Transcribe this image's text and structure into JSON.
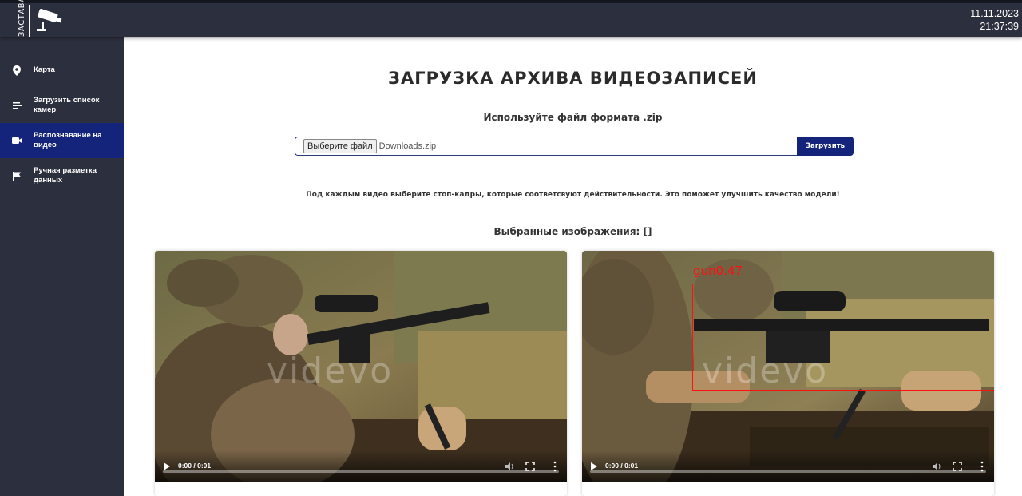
{
  "header": {
    "logo_text": "ЗАСТАВА",
    "date": "11.11.2023",
    "time": "21:37:39"
  },
  "sidebar": {
    "items": [
      {
        "label": "Карта",
        "icon": "map-pin-icon",
        "active": false
      },
      {
        "label": "Загрузить список камер",
        "icon": "list-icon",
        "active": false
      },
      {
        "label": "Распознавание на видео",
        "icon": "video-camera-icon",
        "active": true
      },
      {
        "label": "Ручная разметка данных",
        "icon": "flag-icon",
        "active": false
      }
    ]
  },
  "main": {
    "title": "ЗАГРУЗКА АРХИВА ВИДЕОЗАПИСЕЙ",
    "hint": "Используйте файл формата .zip",
    "file_button_label": "Выберите файл",
    "file_name": "Downloads.zip",
    "submit_label": "Загрузить",
    "instruction": "Под каждым видео выберите стоп-кадры, которые соответсвуют действительности. Это поможет улучшить качество модели!",
    "selected_label": "Выбранные изображения: []"
  },
  "videos": [
    {
      "time": "0:00 / 0:01",
      "watermark": "videvo",
      "progress": 0.0,
      "detection": null
    },
    {
      "time": "0:00 / 0:01",
      "watermark": "videvo",
      "progress": 0.0,
      "detection": {
        "label": "gun0.47"
      }
    }
  ],
  "colors": {
    "sidebar_bg": "#2c2f3d",
    "accent": "#14247a",
    "detection": "#ff1010"
  }
}
